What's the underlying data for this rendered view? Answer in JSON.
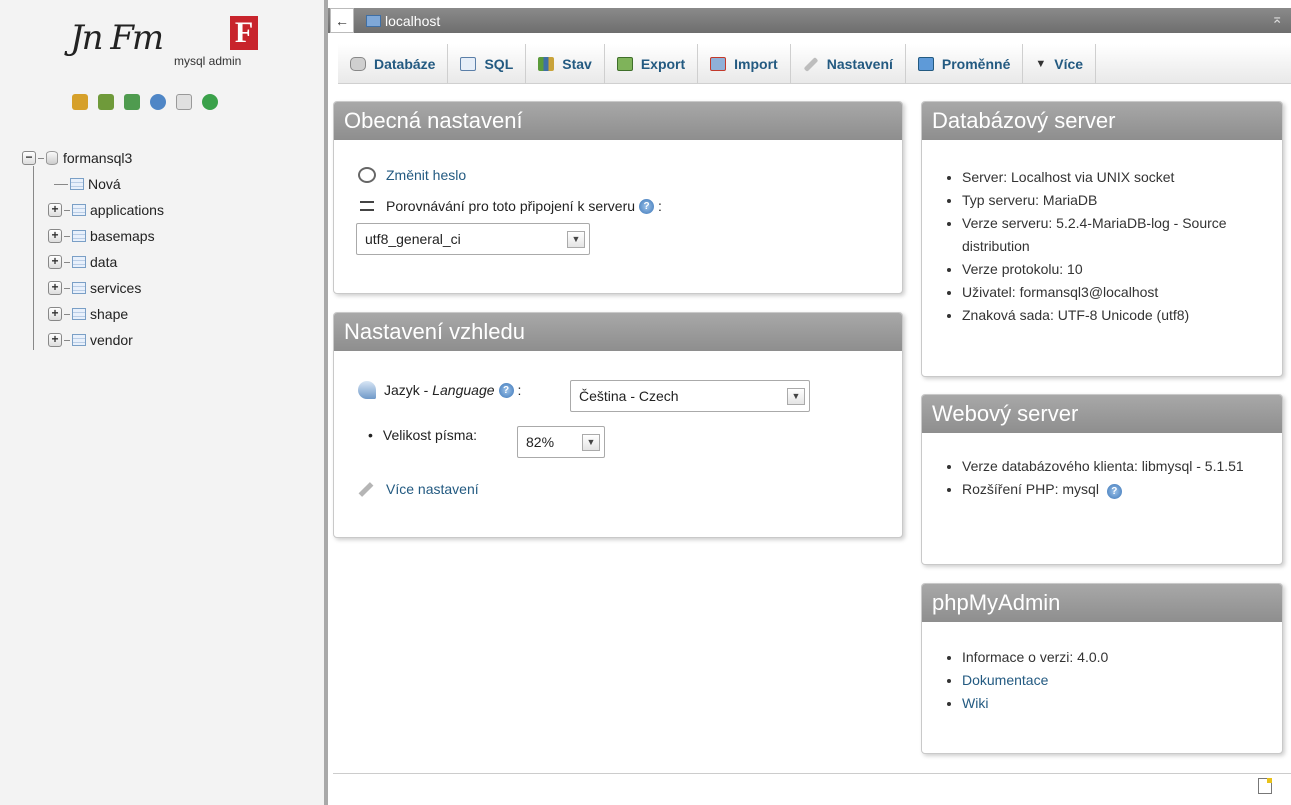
{
  "logo": {
    "signature": "Jn Fm",
    "letter": "F",
    "subtitle": "mysql admin"
  },
  "nav_icons": [
    "home-icon",
    "exit-icon",
    "query-icon",
    "help-icon",
    "docs-icon",
    "reload-icon"
  ],
  "tree": {
    "root": "formansql3",
    "items": [
      {
        "label": "Nová",
        "type": "new"
      },
      {
        "label": "applications",
        "type": "db"
      },
      {
        "label": "basemaps",
        "type": "db"
      },
      {
        "label": "data",
        "type": "db"
      },
      {
        "label": "services",
        "type": "db"
      },
      {
        "label": "shape",
        "type": "db"
      },
      {
        "label": "vendor",
        "type": "db"
      }
    ]
  },
  "topbar": {
    "server": "localhost"
  },
  "tabs": [
    "Databáze",
    "SQL",
    "Stav",
    "Export",
    "Import",
    "Nastavení",
    "Proměnné",
    "Více"
  ],
  "general": {
    "title": "Obecná nastavení",
    "change_password": "Změnit heslo",
    "collation_label": "Porovnávání pro toto připojení k serveru",
    "collation_value": "utf8_general_ci"
  },
  "appearance": {
    "title": "Nastavení vzhledu",
    "language_label": "Jazyk -",
    "language_label_en": "Language",
    "language_value": "Čeština - Czech",
    "font_size_label": "Velikost písma:",
    "font_size_value": "82%",
    "more_settings": "Více nastavení"
  },
  "db_server": {
    "title": "Databázový server",
    "items": [
      "Server: Localhost via UNIX socket",
      "Typ serveru: MariaDB",
      "Verze serveru: 5.2.4-MariaDB-log - Source distribution",
      "Verze protokolu: 10",
      "Uživatel: formansql3@localhost",
      "Znaková sada: UTF-8 Unicode (utf8)"
    ]
  },
  "web_server": {
    "title": "Webový server",
    "items": [
      "Verze databázového klienta: libmysql - 5.1.51",
      "Rozšíření PHP: mysql"
    ]
  },
  "phpmyadmin": {
    "title": "phpMyAdmin",
    "items": [
      "Informace o verzi: 4.0.0",
      "Dokumentace",
      "Wiki"
    ]
  }
}
